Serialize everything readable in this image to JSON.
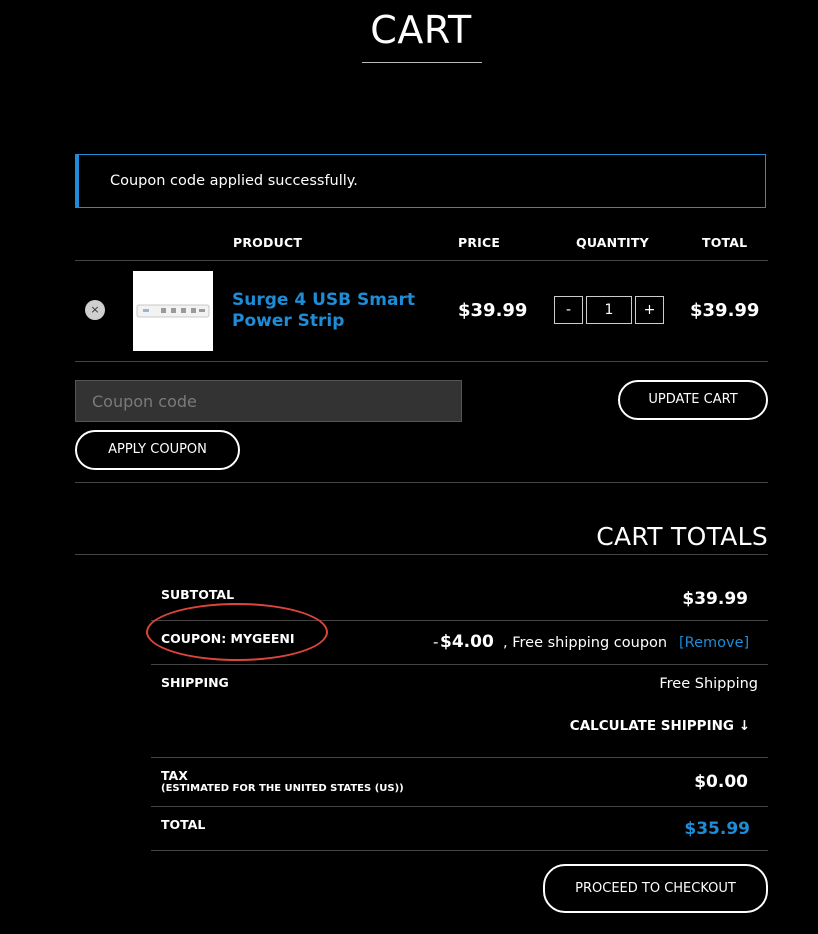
{
  "page": {
    "title": "CART"
  },
  "notice": {
    "message": "Coupon code applied successfully."
  },
  "table": {
    "headers": {
      "product": "PRODUCT",
      "price": "PRICE",
      "quantity": "QUANTITY",
      "total": "TOTAL"
    },
    "items": [
      {
        "remove_symbol": "×",
        "name_line1": "Surge 4 USB Smart",
        "name_line2": "Power Strip",
        "price": "$39.99",
        "quantity": "1",
        "total": "$39.99"
      }
    ],
    "qty_minus": "-",
    "qty_plus": "+"
  },
  "coupon": {
    "placeholder": "Coupon code",
    "apply_label": "APPLY COUPON"
  },
  "update_cart_label": "UPDATE CART",
  "totals": {
    "title": "CART TOTALS",
    "subtotal_label": "SUBTOTAL",
    "subtotal_value": "$39.99",
    "coupon_label": "COUPON: MYGEENI",
    "coupon_sign": "-",
    "coupon_amount": "$4.00",
    "coupon_note": ", Free shipping coupon",
    "coupon_remove": "[Remove]",
    "shipping_label": "SHIPPING",
    "shipping_value": "Free Shipping",
    "calculate_shipping": "CALCULATE SHIPPING",
    "calculate_arrow": "↓",
    "tax_label": "TAX",
    "tax_sublabel": "(ESTIMATED FOR THE UNITED STATES (US))",
    "tax_value": "$0.00",
    "total_label": "TOTAL",
    "total_value": "$35.99"
  },
  "checkout_label": "PROCEED TO CHECKOUT",
  "colors": {
    "accent": "#1e8cd6",
    "background": "#000000",
    "highlight_circle": "#e0453d"
  }
}
